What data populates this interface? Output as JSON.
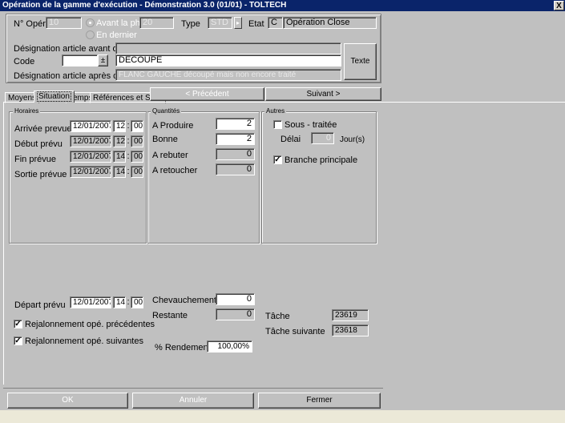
{
  "window": {
    "title": "Opération de la gamme d'exécution - Démonstration 3.0 (01/01) - TOLTECH",
    "close_glyph": "X"
  },
  "header": {
    "nopér_label": "N° Opér",
    "nopér_value": "10",
    "avant_label": "Avant la phase",
    "avant_value": "20",
    "en_dernier_label": "En dernier",
    "type_label": "Type",
    "type_value": "STD",
    "type_spin": "▸",
    "etat_label": "Etat",
    "etat_code": "C",
    "etat_value": "Opération Close",
    "desig_avant_label": "Désignation article avant opé.",
    "desig_avant_value": "",
    "code_label": "Code",
    "code_value": "",
    "code_dropdown": "±",
    "code_desc": "DECOUPE",
    "desig_apres_label": "Désignation article après opé.",
    "desig_apres_value": "FLANC GAUCHE découpé mais non encore traité",
    "texte_button": "Texte"
  },
  "tabs": [
    {
      "label": "Moyens"
    },
    {
      "label": "Situation"
    },
    {
      "label": "Temps"
    },
    {
      "label": "Références et Suivi"
    }
  ],
  "nav": {
    "precedent": "< Précédent",
    "suivant": "Suivant >"
  },
  "horaires": {
    "title": "Horaires",
    "rows": [
      {
        "label": "Arrivée prevue",
        "date": "12/01/2007",
        "hour": "12",
        "min": "00"
      },
      {
        "label": "Début prévu",
        "date": "12/01/2007",
        "hour": "12",
        "min": "00"
      },
      {
        "label": "Fin prévue",
        "date": "12/01/2007",
        "hour": "14",
        "min": "00"
      },
      {
        "label": "Sortie prévue",
        "date": "12/01/2007",
        "hour": "14",
        "min": "00"
      }
    ]
  },
  "quantites": {
    "title": "Quantités",
    "rows": [
      {
        "label": "A Produire",
        "value": "2"
      },
      {
        "label": "Bonne",
        "value": "2"
      },
      {
        "label": "A rebuter",
        "value": "0"
      },
      {
        "label": "A retoucher",
        "value": "0"
      }
    ]
  },
  "autres": {
    "title": "Autres",
    "sous_traitee_label": "Sous - traitée",
    "delai_label": "Délai",
    "delai_value": "0",
    "jours_label": "Jour(s)",
    "branche_label": "Branche principale",
    "check_glyph": "✓"
  },
  "bottom": {
    "depart_label": "Départ prévu",
    "depart_date": "12/01/2007",
    "depart_hour": "14",
    "depart_min": "00",
    "rejal_prec_label": "Rejalonnement opé. précédentes",
    "rejal_suiv_label": "Rejalonnement opé. suivantes",
    "chevauchement_label": "Chevauchement",
    "chevauchement_value": "0",
    "restante_label": "Restante",
    "restante_value": "0",
    "rendement_label": "% Rendement",
    "rendement_value": "100,00%",
    "tache_label": "Tâche",
    "tache_value": "23619",
    "tache_suiv_label": "Tâche suivante",
    "tache_suiv_value": "23618"
  },
  "footer": {
    "ok": "OK",
    "annuler": "Annuler",
    "fermer": "Fermer"
  }
}
